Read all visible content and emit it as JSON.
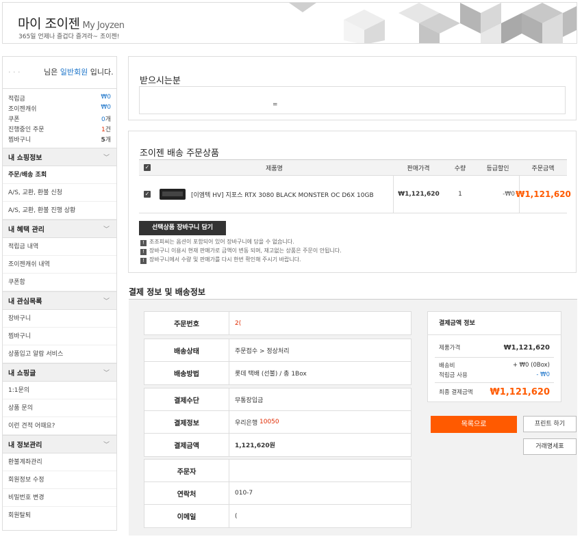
{
  "header": {
    "title": "마이 조이젠",
    "title_en": "My Joyzen",
    "subtitle": "365일 언제나 즐겁다 즐겨라~ 조이젠!"
  },
  "sidebar": {
    "user_suffix": "님은",
    "grade": "일반회원",
    "grade_suffix": "입니다.",
    "stats": [
      {
        "label": "적립금",
        "value": "₩0"
      },
      {
        "label": "조이젠캐쉬",
        "value": "₩0"
      },
      {
        "label": "쿠폰",
        "value": "0",
        "unit": "개"
      },
      {
        "label": "진행중인 주문",
        "value": "1",
        "unit": "건"
      },
      {
        "label": "찜바구니",
        "value": "5",
        "unit": "개"
      }
    ],
    "sections": [
      {
        "title": "내 쇼핑정보",
        "items": [
          "주문/배송 조회",
          "A/S, 교환, 환불 신청",
          "A/S, 교환, 환불 진행 상황"
        ]
      },
      {
        "title": "내 혜택 관리",
        "items": [
          "적립금 내역",
          "조이젠캐쉬 내역",
          "쿠폰함"
        ]
      },
      {
        "title": "내 관심목록",
        "items": [
          "장바구니",
          "찜바구니",
          "상품입고 알람 서비스"
        ]
      },
      {
        "title": "내 쇼핑글",
        "items": [
          "1:1문의",
          "상품 문의",
          "이런 견적 어때요?"
        ]
      },
      {
        "title": "내 정보관리",
        "items": [
          "환불계좌관리",
          "회원정보 수정",
          "비밀번호 변경",
          "회원탈퇴"
        ]
      }
    ]
  },
  "recipient": {
    "title": "받으시는분",
    "value": "="
  },
  "order": {
    "title": "조이젠 배송 주문상품",
    "columns": [
      "제품명",
      "판매가격",
      "수량",
      "등급할인",
      "주문금액"
    ],
    "items": [
      {
        "name": "[이엠텍 HV] 지포스 RTX 3080 BLACK MONSTER OC D6X 10GB",
        "price": "₩1,121,620",
        "qty": "1",
        "discount": "-₩0",
        "total": "₩1,121,620"
      }
    ],
    "cart_button": "선택상품 장바구니 담기",
    "notes": [
      "조조피씨는 옵션이 포함되어 있어 장바구니에 담을 수 없습니다.",
      "장바구니 이용시 현재 판매가로 금액이 변동 되며, 재고없는 상품은 주문이 안됩니다.",
      "장바구니에서 수량 및 판매가를 다시 한번 확인해 주시기 바랍니다."
    ]
  },
  "payment": {
    "title": "결제 정보 및 배송정보",
    "order_no_label": "주문번호",
    "order_no": "2(",
    "status_label": "배송상태",
    "status": "주문접수 > 정상처리",
    "method_label": "배송방법",
    "method": "롯데 택배 (선불) / 총 1Box",
    "pay_means_label": "결제수단",
    "pay_means": "무통장입금",
    "pay_info_label": "결제정보",
    "pay_info_bank": "우리은행",
    "pay_info_account": "10050",
    "pay_amount_label": "결제금액",
    "pay_amount": "1,121,620원",
    "orderer_label": "주문자",
    "orderer": "",
    "contact_label": "연락처",
    "contact": "010-7",
    "email_label": "이메일",
    "email": "("
  },
  "summary": {
    "title": "결제금액 정보",
    "product_price_label": "제품가격",
    "product_price": "₩1,121,620",
    "shipping_label": "배송비",
    "shipping": "+ ₩0 (0Box)",
    "points_label": "적립금 사용",
    "points": "- ₩0",
    "final_label": "최종 결제금액",
    "final": "₩1,121,620"
  },
  "buttons": {
    "list": "목록으로",
    "print": "프린트 하기",
    "statement": "거래명세표"
  },
  "colors": {
    "accent": "#ff5a00",
    "link_blue": "#1a73c9"
  }
}
